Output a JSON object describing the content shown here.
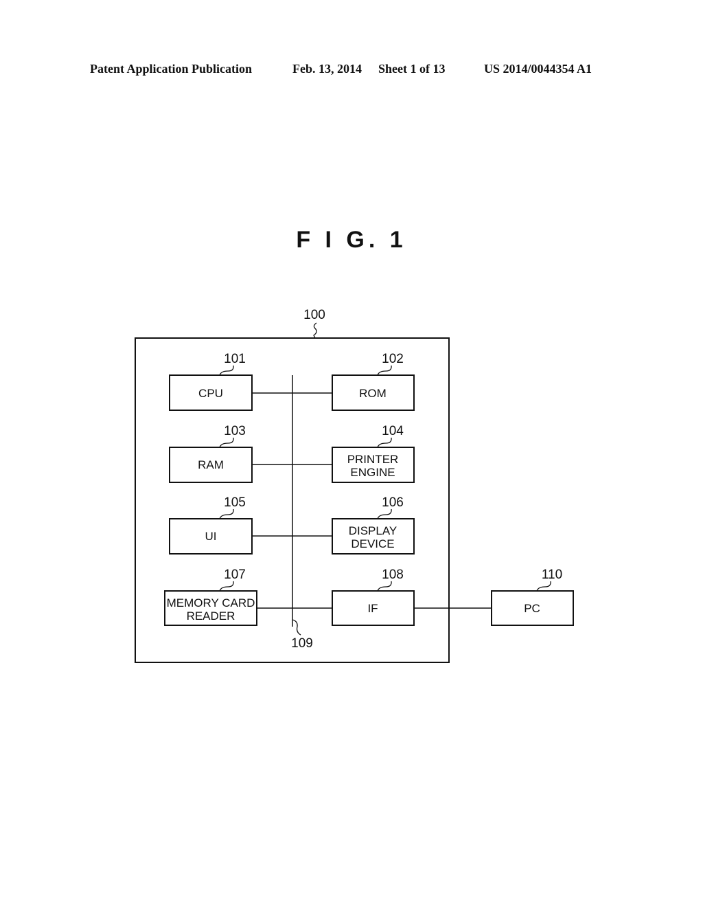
{
  "header": {
    "publication": "Patent Application Publication",
    "date": "Feb. 13, 2014",
    "sheet": "Sheet 1 of 13",
    "number": "US 2014/0044354 A1"
  },
  "figure": {
    "title": "F I G.  1"
  },
  "diagram": {
    "container": {
      "ref": "100"
    },
    "bus": {
      "ref": "109"
    },
    "blocks": [
      {
        "id": "cpu",
        "ref": "101",
        "lines": [
          "CPU"
        ]
      },
      {
        "id": "rom",
        "ref": "102",
        "lines": [
          "ROM"
        ]
      },
      {
        "id": "ram",
        "ref": "103",
        "lines": [
          "RAM"
        ]
      },
      {
        "id": "printer-engine",
        "ref": "104",
        "lines": [
          "PRINTER",
          "ENGINE"
        ]
      },
      {
        "id": "ui",
        "ref": "105",
        "lines": [
          "UI"
        ]
      },
      {
        "id": "display-device",
        "ref": "106",
        "lines": [
          "DISPLAY",
          "DEVICE"
        ]
      },
      {
        "id": "memory-card-reader",
        "ref": "107",
        "lines": [
          "MEMORY CARD",
          "READER"
        ]
      },
      {
        "id": "if",
        "ref": "108",
        "lines": [
          "IF"
        ]
      },
      {
        "id": "pc",
        "ref": "110",
        "lines": [
          "PC"
        ]
      }
    ]
  }
}
